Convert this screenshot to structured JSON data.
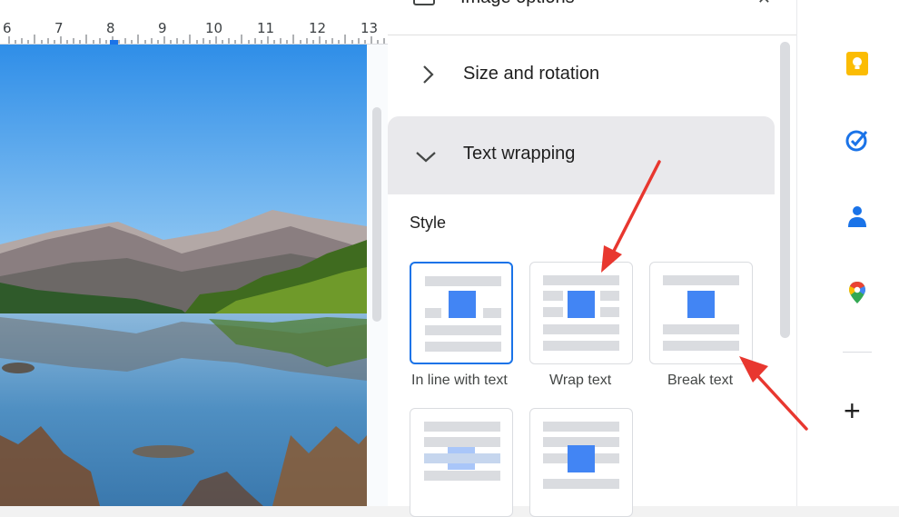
{
  "ruler": {
    "numbers": [
      "6",
      "7",
      "8",
      "9",
      "10",
      "11",
      "12",
      "13"
    ]
  },
  "panel": {
    "title": "Image options",
    "sections": {
      "size_rotation": "Size and rotation",
      "text_wrapping": "Text wrapping"
    },
    "style_label": "Style",
    "options": [
      "In line with text",
      "Wrap text",
      "Break text"
    ]
  },
  "rail": {
    "icons": [
      "keep-icon",
      "tasks-icon",
      "contacts-icon",
      "maps-icon",
      "add-icon"
    ]
  },
  "colors": {
    "accent": "#1a73e8",
    "arrow": "#e8372f",
    "section_bg": "#e9e9ec"
  }
}
